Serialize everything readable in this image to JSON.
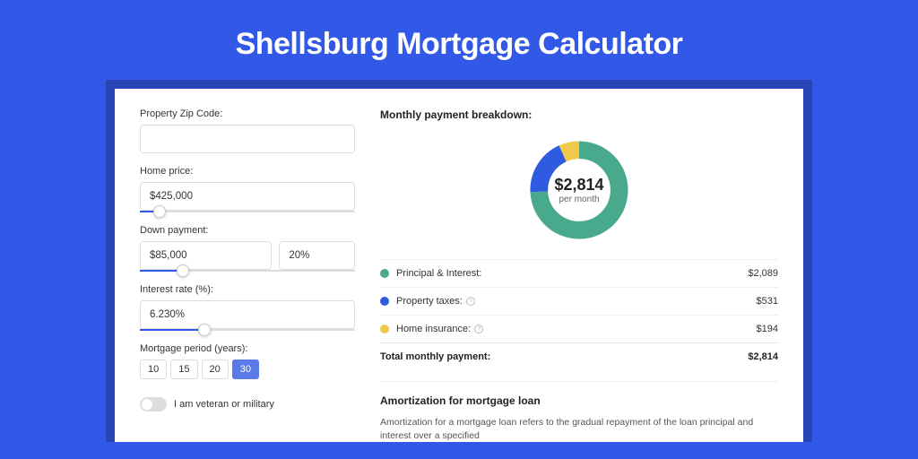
{
  "page": {
    "title": "Shellsburg Mortgage Calculator"
  },
  "form": {
    "zip": {
      "label": "Property Zip Code:",
      "value": ""
    },
    "home_price": {
      "label": "Home price:",
      "value": "$425,000",
      "slider_pct": 9
    },
    "down_payment": {
      "label": "Down payment:",
      "amount": "$85,000",
      "percent": "20%",
      "slider_pct": 20
    },
    "interest": {
      "label": "Interest rate (%):",
      "value": "6.230%",
      "slider_pct": 30
    },
    "period": {
      "label": "Mortgage period (years):",
      "options": [
        "10",
        "15",
        "20",
        "30"
      ],
      "selected": "30"
    },
    "veteran": {
      "label": "I am veteran or military",
      "on": false
    }
  },
  "breakdown": {
    "heading": "Monthly payment breakdown:",
    "center_amount": "$2,814",
    "center_sub": "per month",
    "items": [
      {
        "label": "Principal & Interest:",
        "value": "$2,089",
        "color": "#49a98c",
        "info": false
      },
      {
        "label": "Property taxes:",
        "value": "$531",
        "color": "#2f5be0",
        "info": true
      },
      {
        "label": "Home insurance:",
        "value": "$194",
        "color": "#f0c94b",
        "info": true
      }
    ],
    "total": {
      "label": "Total monthly payment:",
      "value": "$2,814"
    }
  },
  "chart_data": {
    "type": "pie",
    "title": "Monthly payment breakdown",
    "total": 2814,
    "series": [
      {
        "name": "Principal & Interest",
        "value": 2089,
        "color": "#49a98c"
      },
      {
        "name": "Property taxes",
        "value": 531,
        "color": "#2f5be0"
      },
      {
        "name": "Home insurance",
        "value": 194,
        "color": "#f0c94b"
      }
    ]
  },
  "amortization": {
    "title": "Amortization for mortgage loan",
    "body": "Amortization for a mortgage loan refers to the gradual repayment of the loan principal and interest over a specified"
  }
}
